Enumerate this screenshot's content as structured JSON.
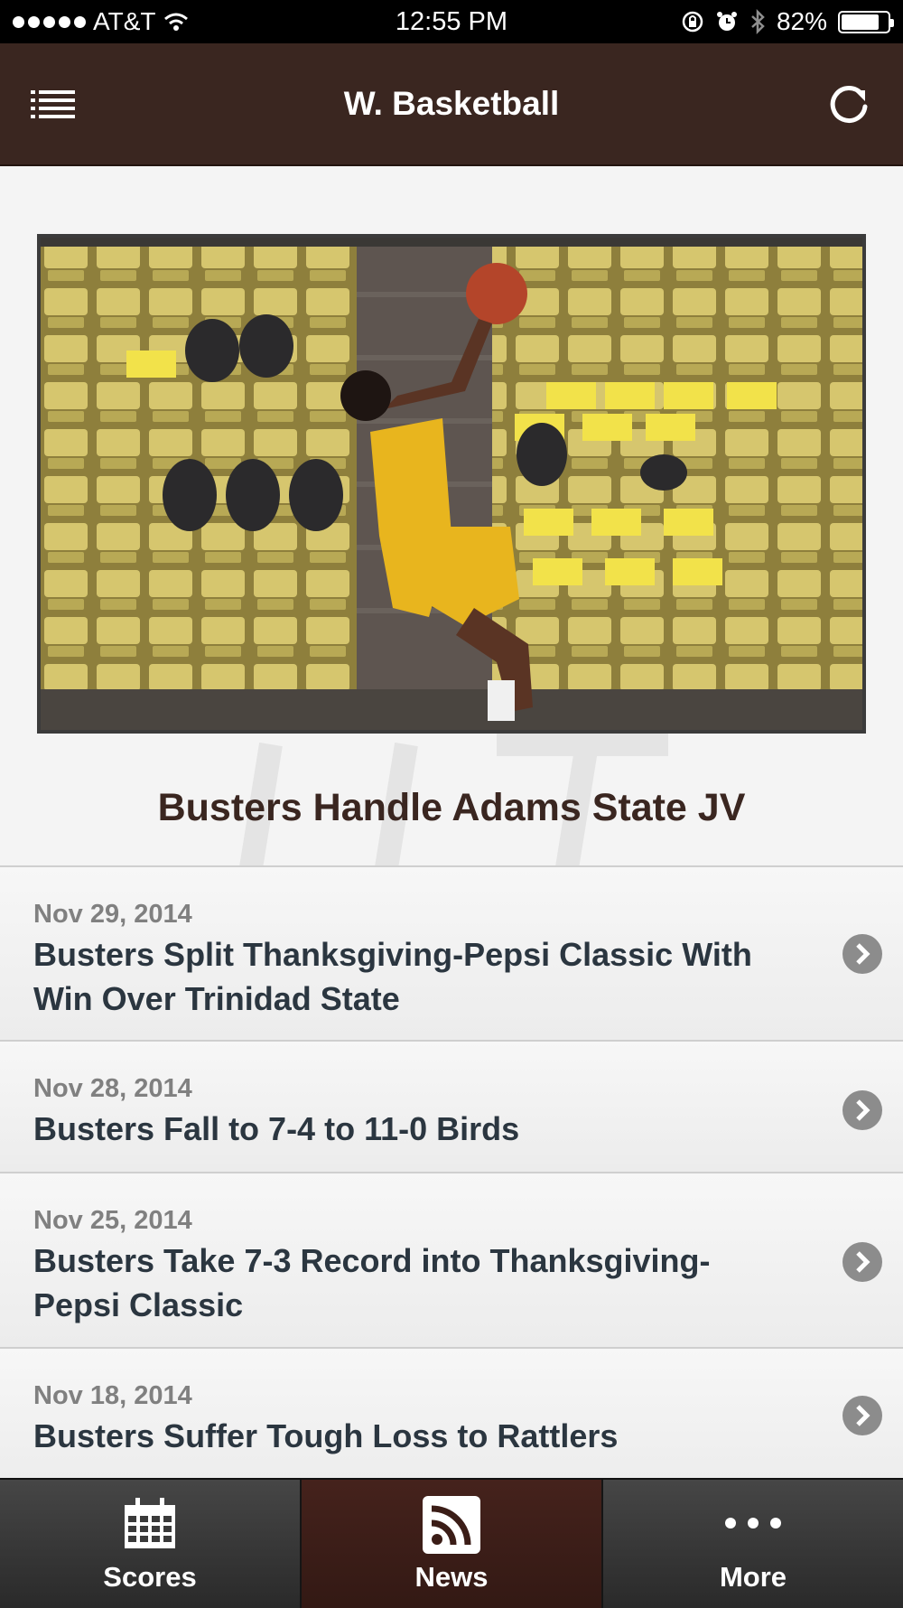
{
  "status_bar": {
    "carrier": "AT&T",
    "time": "12:55 PM",
    "battery_percent": "82%",
    "battery_level": 0.82
  },
  "nav": {
    "title": "W. Basketball",
    "menu_icon": "list-icon",
    "refresh_icon": "refresh-icon"
  },
  "featured": {
    "title": "Busters Handle Adams State JV"
  },
  "news": [
    {
      "date": "Nov 29, 2014",
      "headline_line1": "Busters Split Thanksgiving-Pepsi Classic With",
      "headline_line2": "Win Over Trinidad State"
    },
    {
      "date": "Nov 28, 2014",
      "headline_line1": "Busters Fall to 7-4 to 11-0 Birds",
      "headline_line2": ""
    },
    {
      "date": "Nov 25, 2014",
      "headline_line1": "Busters Take 7-3 Record into Thanksgiving-",
      "headline_line2": "Pepsi Classic"
    },
    {
      "date": "Nov 18, 2014",
      "headline_line1": "Busters Suffer Tough Loss to Rattlers",
      "headline_line2": ""
    }
  ],
  "tabs": [
    {
      "label": "Scores",
      "icon": "calendar-icon"
    },
    {
      "label": "News",
      "icon": "rss-icon",
      "active": true
    },
    {
      "label": "More",
      "icon": "more-dots-icon"
    }
  ],
  "colors": {
    "brand_brown": "#3a2620",
    "active_tab": "#3b1d17",
    "headline_text": "#2b3640"
  }
}
